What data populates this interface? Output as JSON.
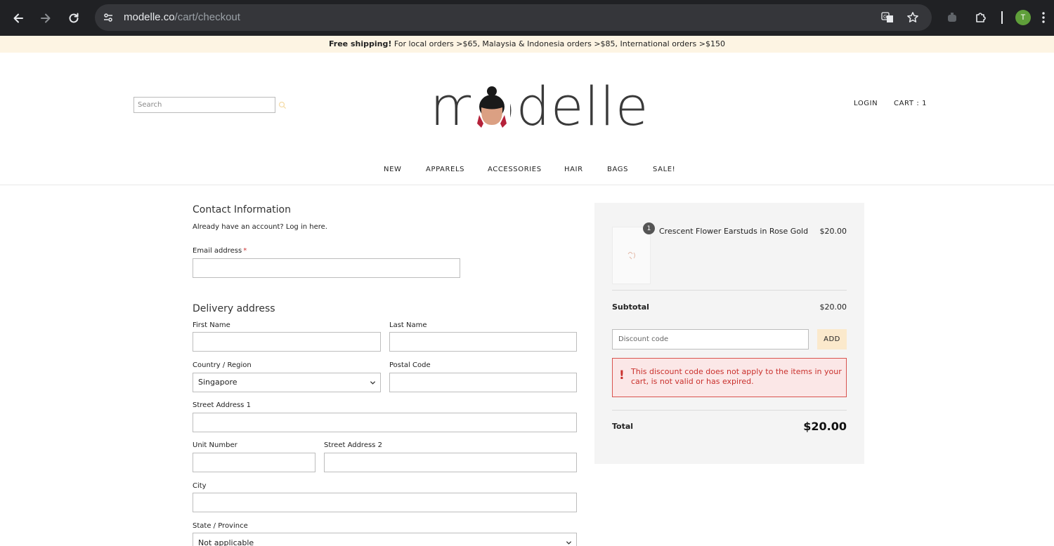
{
  "browser": {
    "url_host": "modelle.co",
    "url_path": "/cart/checkout",
    "profile_initial": "T"
  },
  "promo": {
    "bold": "Free shipping!",
    "text": " For local orders >$65, Malaysia & Indonesia orders >$85, International orders >$150"
  },
  "header": {
    "search_placeholder": "Search",
    "logo_text": "modelle",
    "login": "LOGIN",
    "cart": "CART : 1"
  },
  "nav": [
    "NEW",
    "APPARELS",
    "ACCESSORIES",
    "HAIR",
    "BAGS",
    "SALE!"
  ],
  "contact": {
    "title": "Contact Information",
    "login_prompt": "Already have an account? Log in here.",
    "email_label": "Email address",
    "email_required": "*",
    "email_value": ""
  },
  "delivery": {
    "title": "Delivery address",
    "first_name_label": "First Name",
    "last_name_label": "Last Name",
    "country_label": "Country / Region",
    "country_value": "Singapore",
    "postal_label": "Postal Code",
    "street1_label": "Street Address 1",
    "unit_label": "Unit Number",
    "street2_label": "Street Address 2",
    "city_label": "City",
    "state_label": "State / Province",
    "state_value": "Not applicable"
  },
  "summary": {
    "item": {
      "quantity": "1",
      "name": "Crescent Flower Earstuds in Rose Gold",
      "price": "$20.00"
    },
    "subtotal_label": "Subtotal",
    "subtotal_value": "$20.00",
    "discount_placeholder": "Discount code",
    "add_label": "ADD",
    "error_mark": "!",
    "error_message": "This discount code does not apply to the items in your cart, is not valid or has expired.",
    "total_label": "Total",
    "total_value": "$20.00"
  },
  "colors": {
    "promo_bg": "#fdf4e3",
    "summary_bg": "#f4f4f4",
    "add_button_bg": "#fbe9cc",
    "error_border": "#d9534f",
    "error_text": "#c9302c",
    "avatar_bg": "#5f9f3a"
  }
}
